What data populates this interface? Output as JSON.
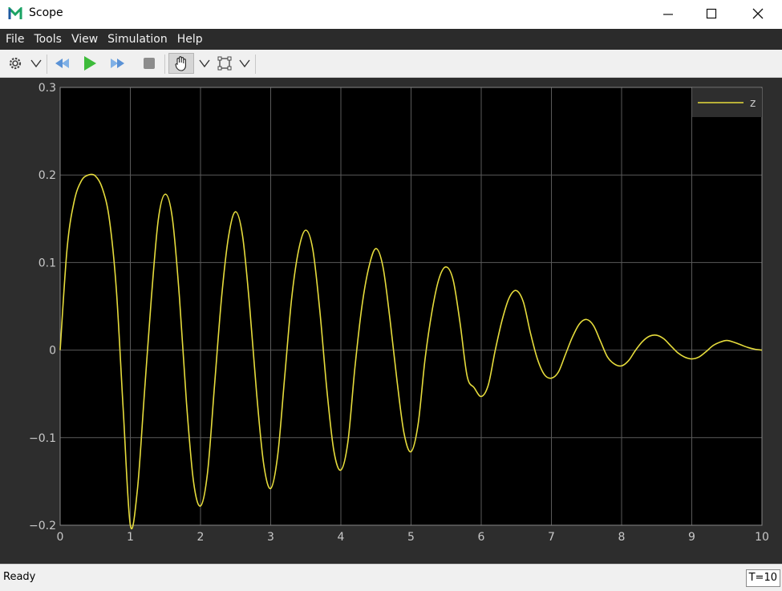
{
  "window": {
    "title": "Scope",
    "accent_color": "#1aa364"
  },
  "menu": {
    "items": [
      "File",
      "Tools",
      "View",
      "Simulation",
      "Help"
    ]
  },
  "toolbar": {
    "icons": [
      "gear-icon",
      "chevron-down-icon",
      "step-back-icon",
      "play-icon",
      "step-forward-icon",
      "stop-icon",
      "pan-hand-icon",
      "chevron-down-icon",
      "zoom-box-icon",
      "chevron-down-icon"
    ]
  },
  "status": {
    "text": "Ready",
    "time": "T=10"
  },
  "chart_data": {
    "type": "line",
    "title": "",
    "xlabel": "",
    "ylabel": "",
    "xlim": [
      0,
      10
    ],
    "ylim": [
      -0.2,
      0.3
    ],
    "x_ticks": [
      0,
      1,
      2,
      3,
      4,
      5,
      6,
      7,
      8,
      9,
      10
    ],
    "y_ticks": [
      -0.2,
      -0.1,
      0,
      0.1,
      0.2,
      0.3
    ],
    "x_tick_labels": [
      "0",
      "1",
      "2",
      "3",
      "4",
      "5",
      "6",
      "7",
      "8",
      "9",
      "10"
    ],
    "y_tick_labels": [
      "−0.2",
      "−0.1",
      "0",
      "0.1",
      "0.2",
      "0.3"
    ],
    "grid": true,
    "background": "#000000",
    "legend_position": "top-right",
    "series": [
      {
        "name": "z",
        "color": "#e6dc3c",
        "x": [
          0,
          0.1,
          0.2,
          0.3,
          0.4,
          0.5,
          0.6,
          0.7,
          0.8,
          0.9,
          1.0,
          1.1,
          1.2,
          1.3,
          1.4,
          1.5,
          1.6,
          1.7,
          1.8,
          1.9,
          2.0,
          2.1,
          2.2,
          2.3,
          2.4,
          2.5,
          2.6,
          2.7,
          2.8,
          2.9,
          3.0,
          3.1,
          3.2,
          3.3,
          3.4,
          3.5,
          3.6,
          3.7,
          3.8,
          3.9,
          4.0,
          4.1,
          4.2,
          4.3,
          4.4,
          4.5,
          4.6,
          4.7,
          4.8,
          4.9,
          5.0,
          5.1,
          5.2,
          5.3,
          5.4,
          5.5,
          5.6,
          5.7,
          5.8,
          5.9,
          6.0,
          6.1,
          6.2,
          6.3,
          6.4,
          6.5,
          6.6,
          6.7,
          6.8,
          6.9,
          7.0,
          7.1,
          7.2,
          7.3,
          7.4,
          7.5,
          7.6,
          7.7,
          7.8,
          7.9,
          8.0,
          8.1,
          8.2,
          8.3,
          8.4,
          8.5,
          8.6,
          8.7,
          8.8,
          8.9,
          9.0,
          9.1,
          9.2,
          9.3,
          9.4,
          9.5,
          9.6,
          9.7,
          9.8,
          9.9,
          10.0
        ],
        "y": [
          0,
          0.117,
          0.17,
          0.193,
          0.2,
          0.199,
          0.185,
          0.15,
          0.07,
          -0.07,
          -0.2,
          -0.16,
          -0.05,
          0.06,
          0.15,
          0.178,
          0.15,
          0.06,
          -0.06,
          -0.15,
          -0.178,
          -0.14,
          -0.04,
          0.06,
          0.13,
          0.158,
          0.13,
          0.05,
          -0.05,
          -0.13,
          -0.158,
          -0.12,
          -0.03,
          0.06,
          0.115,
          0.137,
          0.115,
          0.045,
          -0.045,
          -0.115,
          -0.137,
          -0.105,
          -0.02,
          0.05,
          0.095,
          0.116,
          0.095,
          0.035,
          -0.035,
          -0.095,
          -0.116,
          -0.085,
          -0.01,
          0.045,
          0.082,
          0.095,
          0.08,
          0.03,
          -0.03,
          -0.043,
          -0.053,
          -0.04,
          0.0,
          0.035,
          0.06,
          0.068,
          0.055,
          0.02,
          -0.01,
          -0.028,
          -0.032,
          -0.025,
          -0.005,
          0.015,
          0.03,
          0.035,
          0.028,
          0.01,
          -0.008,
          -0.016,
          -0.018,
          -0.012,
          0.0,
          0.01,
          0.016,
          0.017,
          0.013,
          0.005,
          -0.003,
          -0.008,
          -0.01,
          -0.008,
          -0.002,
          0.005,
          0.009,
          0.011,
          0.009,
          0.006,
          0.003,
          0.001,
          0
        ]
      }
    ]
  }
}
